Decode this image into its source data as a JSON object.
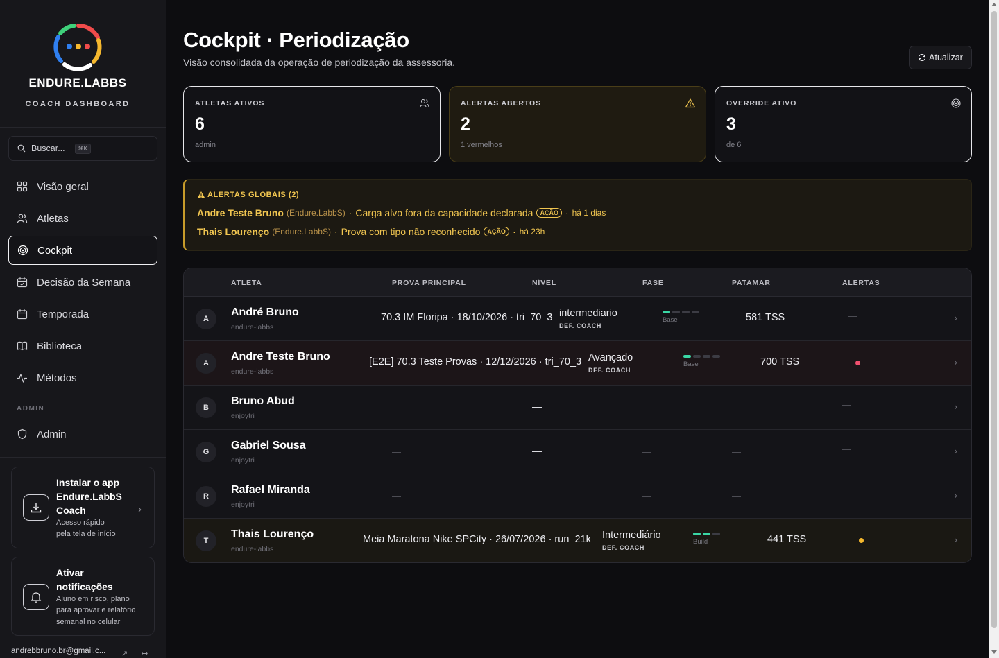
{
  "brand": {
    "name": "ENDURE.LABBS",
    "subtitle": "COACH DASHBOARD"
  },
  "search": {
    "label": "Buscar...",
    "shortcut": "⌘K"
  },
  "nav": [
    {
      "label": "Visão geral",
      "icon": "grid-icon",
      "active": false
    },
    {
      "label": "Atletas",
      "icon": "users-icon",
      "active": false
    },
    {
      "label": "Cockpit",
      "icon": "target-icon",
      "active": true
    },
    {
      "label": "Decisão da Semana",
      "icon": "calendar-check-icon",
      "active": false
    },
    {
      "label": "Temporada",
      "icon": "calendar-icon",
      "active": false
    },
    {
      "label": "Biblioteca",
      "icon": "book-icon",
      "active": false
    },
    {
      "label": "Métodos",
      "icon": "activity-icon",
      "active": false
    }
  ],
  "admin": {
    "heading": "ADMIN",
    "item_label": "Admin"
  },
  "promo_install": {
    "title": "Instalar o app Endure.LabbS Coach",
    "desc_line1": "Acesso rápido",
    "desc_line2": "pela tela de início"
  },
  "promo_notify": {
    "title": "Ativar notificações",
    "desc_line1": "Aluno em risco, plano",
    "desc_line2": "para aprovar e relatório",
    "desc_line3": "semanal no celular"
  },
  "user": {
    "email": "andrebbruno.br@gmail.c..."
  },
  "header": {
    "title": "Cockpit · Periodização",
    "subtitle": "Visão consolidada da operação de periodização da assessoria.",
    "refresh_label": "Atualizar"
  },
  "stats": [
    {
      "label": "ATLETAS ATIVOS",
      "value": "6",
      "sub": "admin",
      "icon": "users-icon"
    },
    {
      "label": "ALERTAS ABERTOS",
      "value": "2",
      "sub": "1 vermelhos",
      "icon": "warning-icon"
    },
    {
      "label": "OVERRIDE ATIVO",
      "value": "3",
      "sub": "de 6",
      "icon": "target-icon"
    }
  ],
  "global_alerts": {
    "heading": "ALERTAS GLOBAIS (2)",
    "items": [
      {
        "name": "Andre Teste Bruno",
        "org": "(Endure.LabbS)",
        "message": "Carga alvo fora da capacidade declarada",
        "badge": "AÇÃO",
        "age": "há 1 dias"
      },
      {
        "name": "Thais Lourenço",
        "org": "(Endure.LabbS)",
        "message": "Prova com tipo não reconhecido",
        "badge": "AÇÃO",
        "age": "há 23h"
      }
    ]
  },
  "table": {
    "columns": [
      "ATLETA",
      "PROVA PRINCIPAL",
      "NÍVEL",
      "FASE",
      "PATAMAR",
      "ALERTAS"
    ],
    "rows": [
      {
        "initial": "A",
        "name": "André Bruno",
        "org": "endure-labbs",
        "race": "70.3 IM Floripa · 18/10/2026 · tri_70_3",
        "level": "intermediario",
        "level_tag": "DEF. COACH",
        "phase": "Base",
        "phase_filled": 1,
        "tss": "581 TSS",
        "alert": "—"
      },
      {
        "initial": "A",
        "name": "Andre Teste Bruno",
        "org": "endure-labbs",
        "race": "[E2E] 70.3 Teste Provas · 12/12/2026 · tri_70_3",
        "level": "Avançado",
        "level_tag": "DEF. COACH",
        "phase": "Base",
        "phase_filled": 1,
        "tss": "700 TSS",
        "alert_color": "#f0506e"
      },
      {
        "initial": "B",
        "name": "Bruno Abud",
        "org": "enjoytri",
        "race": "—",
        "level": "—",
        "phase": "—",
        "tss": "—",
        "alert": "—"
      },
      {
        "initial": "G",
        "name": "Gabriel Sousa",
        "org": "enjoytri",
        "race": "—",
        "level": "—",
        "phase": "—",
        "tss": "—",
        "alert": "—"
      },
      {
        "initial": "R",
        "name": "Rafael Miranda",
        "org": "enjoytri",
        "race": "—",
        "level": "—",
        "phase": "—",
        "tss": "—",
        "alert": "—"
      },
      {
        "initial": "T",
        "name": "Thais Lourenço",
        "org": "endure-labbs",
        "race": "Meia Maratona Nike SPCity · 26/07/2026 · run_21k",
        "level": "Intermediário",
        "level_tag": "DEF. COACH",
        "phase": "Build",
        "phase_filled": 2,
        "tss": "441 TSS",
        "alert_color": "#f5b82e"
      }
    ]
  }
}
